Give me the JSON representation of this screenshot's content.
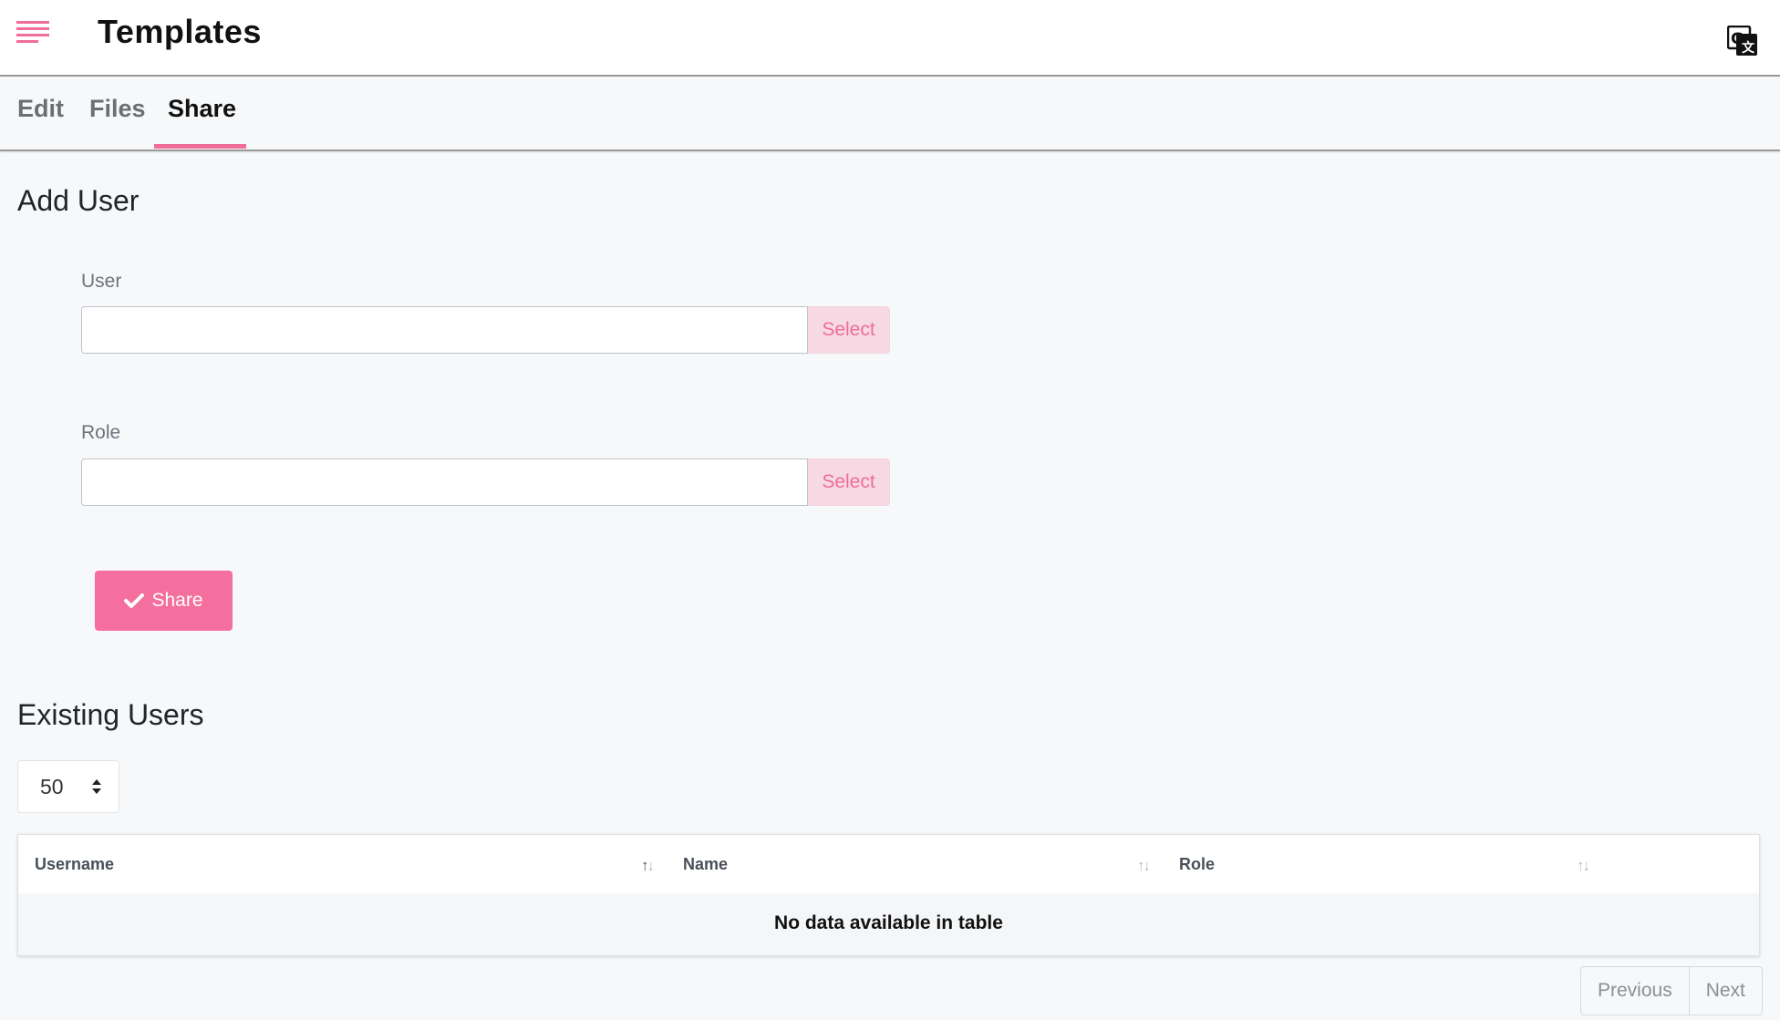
{
  "header": {
    "title": "Templates",
    "menu_icon": "hamburger-menu-icon",
    "translate_icon": "google-translate-icon",
    "accent_color": "#f06c99"
  },
  "tabs": [
    {
      "label": "Edit",
      "active": false
    },
    {
      "label": "Files",
      "active": false
    },
    {
      "label": "Share",
      "active": true
    }
  ],
  "add_user": {
    "title": "Add User",
    "user_label": "User",
    "user_value": "",
    "user_select": "Select",
    "role_label": "Role",
    "role_value": "",
    "role_select": "Select",
    "share_label": "Share",
    "share_icon": "check-icon"
  },
  "existing_users": {
    "title": "Existing Users",
    "page_length": "50",
    "columns": [
      "Username",
      "Name",
      "Role"
    ],
    "empty_message": "No data available in table",
    "pagination": {
      "previous": "Previous",
      "next": "Next"
    }
  }
}
